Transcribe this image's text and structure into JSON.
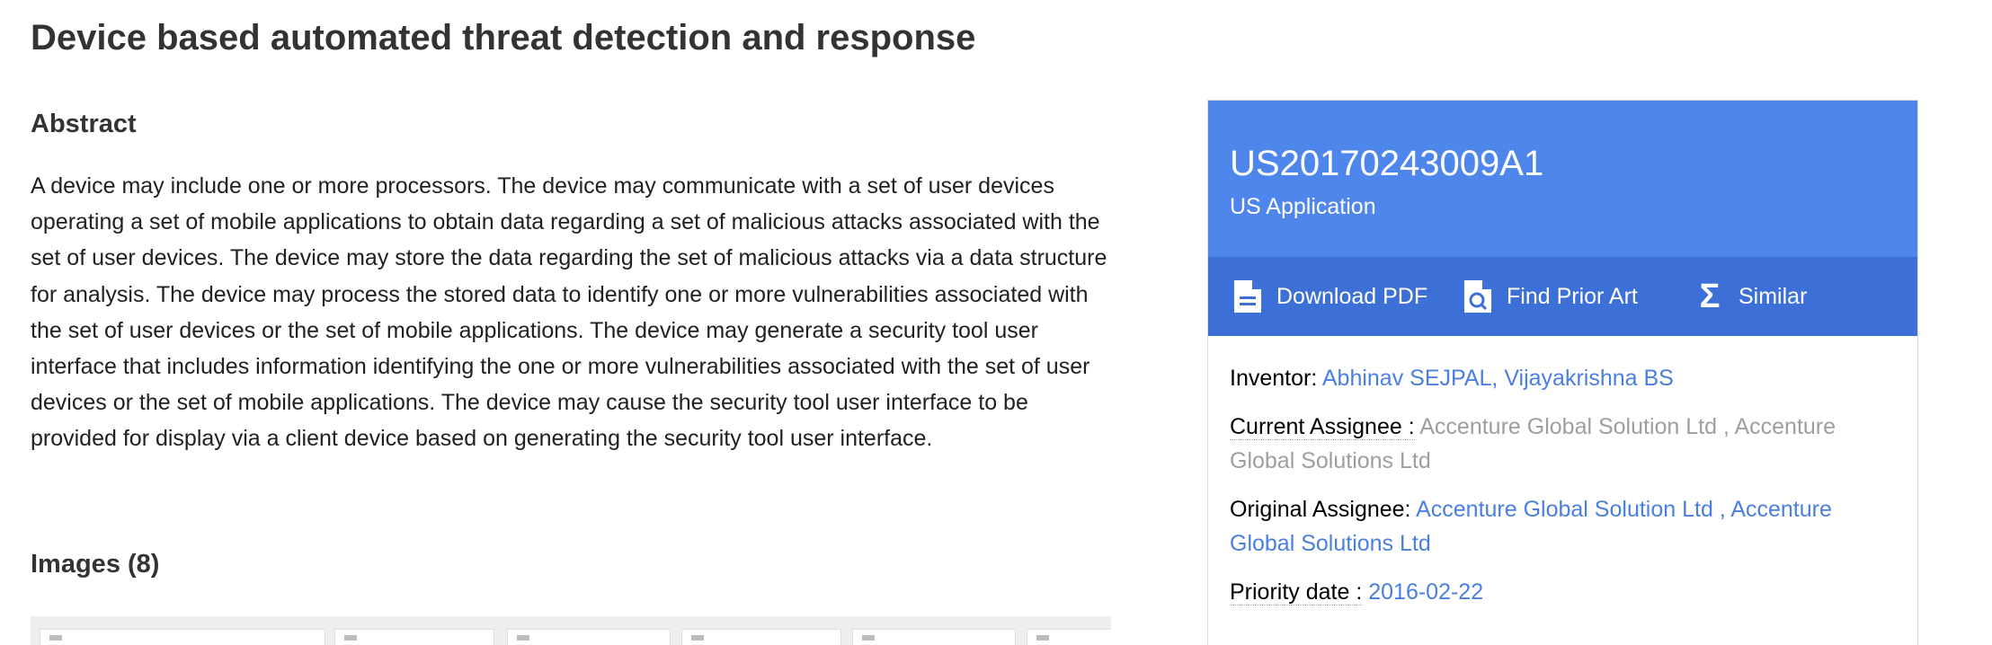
{
  "page": {
    "title": "Device based automated threat detection and response"
  },
  "abstract": {
    "heading": "Abstract",
    "text": "A device may include one or more processors. The device may communicate with a set of user devices operating a set of mobile applications to obtain data regarding a set of malicious attacks associated with the set of user devices. The device may store the data regarding the set of malicious attacks via a data structure for analysis. The device may process the stored data to identify one or more vulnerabilities associated with the set of user devices or the set of mobile applications. The device may generate a security tool user interface that includes information identifying the one or more vulnerabilities associated with the set of user devices or the set of mobile applications. The device may cause the security tool user interface to be provided for display via a client device based on generating the security tool user interface."
  },
  "images": {
    "heading": "Images (8)"
  },
  "card": {
    "publication_number": "US20170243009A1",
    "publication_type": "US Application",
    "actions": {
      "download_pdf": "Download PDF",
      "find_prior_art": "Find Prior Art",
      "similar": "Similar"
    },
    "inventor": {
      "label": "Inventor:",
      "names": [
        "Abhinav SEJPAL",
        "Vijayakrishna BS"
      ]
    },
    "current_assignee": {
      "label": "Current Assignee :",
      "value": "Accenture Global Solution Ltd , Accenture Global Solutions Ltd"
    },
    "original_assignee": {
      "label": "Original Assignee:",
      "value": "Accenture Global Solution Ltd , Accenture Global Solutions Ltd"
    },
    "priority_date": {
      "label": "Priority date :",
      "value": "2016-02-22"
    }
  },
  "colors": {
    "header_blue": "#4f86ec",
    "actions_blue": "#3d70d6",
    "link_blue": "#4a7fe0",
    "muted_gray": "#9e9e9e"
  },
  "icons": [
    "document-icon",
    "search-document-icon",
    "sigma-icon"
  ]
}
